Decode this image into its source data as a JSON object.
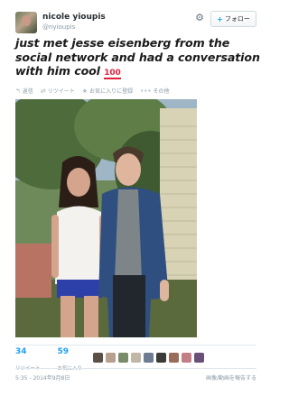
{
  "user": {
    "display_name": "nicole yioupis",
    "handle": "@nyioupis"
  },
  "header": {
    "follow_label": "フォロー"
  },
  "tweet": {
    "text": "just met jesse eisenberg from the social network and had a conversation with him cool",
    "emoji": "💯"
  },
  "actions": [
    {
      "icon": "reply-icon",
      "label": "返信"
    },
    {
      "icon": "retweet-icon",
      "label": "リツイート"
    },
    {
      "icon": "star-icon",
      "label": "お気に入りに登録"
    },
    {
      "icon": "more-icon",
      "label": "その他"
    }
  ],
  "stats": {
    "retweets": {
      "value": "34",
      "label": "リツイート"
    },
    "favorites": {
      "value": "59",
      "label": "お気に入り"
    }
  },
  "timestamp": "5:35 - 2014年9月8日",
  "report_label": "画像/動画を報告する",
  "colors": {
    "link_blue": "#1da1f2",
    "text_gray": "#8899a6",
    "emoji_red": "#e1203a"
  }
}
